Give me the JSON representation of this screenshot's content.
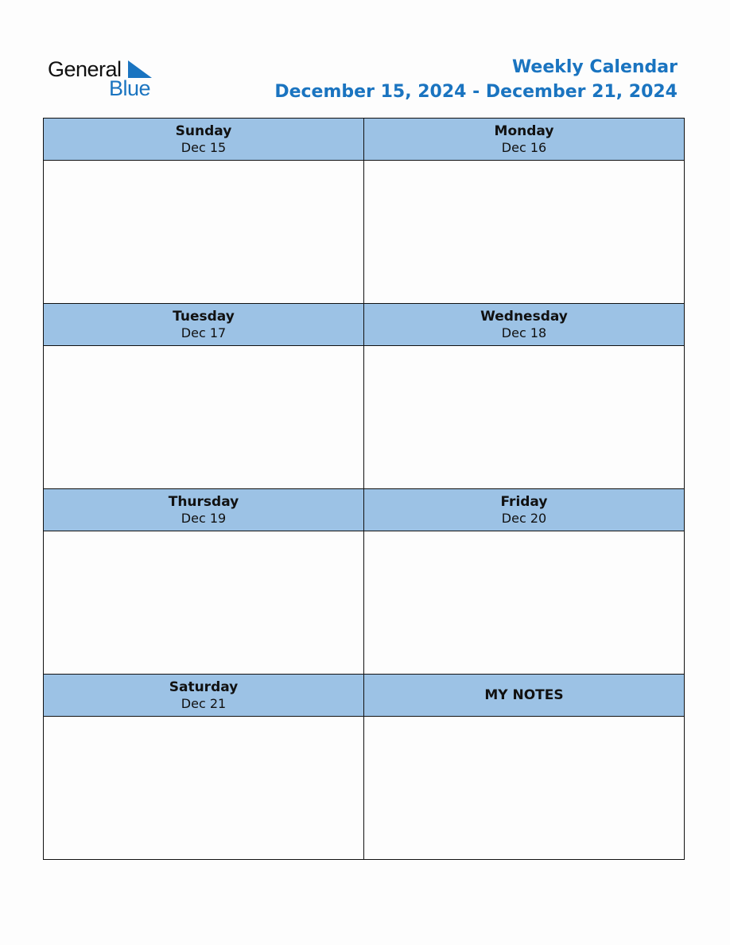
{
  "logo": {
    "word1": "General",
    "word2": "Blue"
  },
  "header": {
    "title": "Weekly Calendar",
    "range": "December 15, 2024 - December 21, 2024"
  },
  "colors": {
    "accent": "#1a74c0",
    "header_fill": "#9cc2e5",
    "border": "#111111"
  },
  "days": [
    {
      "name": "Sunday",
      "date": "Dec 15"
    },
    {
      "name": "Monday",
      "date": "Dec 16"
    },
    {
      "name": "Tuesday",
      "date": "Dec 17"
    },
    {
      "name": "Wednesday",
      "date": "Dec 18"
    },
    {
      "name": "Thursday",
      "date": "Dec 19"
    },
    {
      "name": "Friday",
      "date": "Dec 20"
    },
    {
      "name": "Saturday",
      "date": "Dec 21"
    }
  ],
  "notes": {
    "label": "MY NOTES"
  }
}
